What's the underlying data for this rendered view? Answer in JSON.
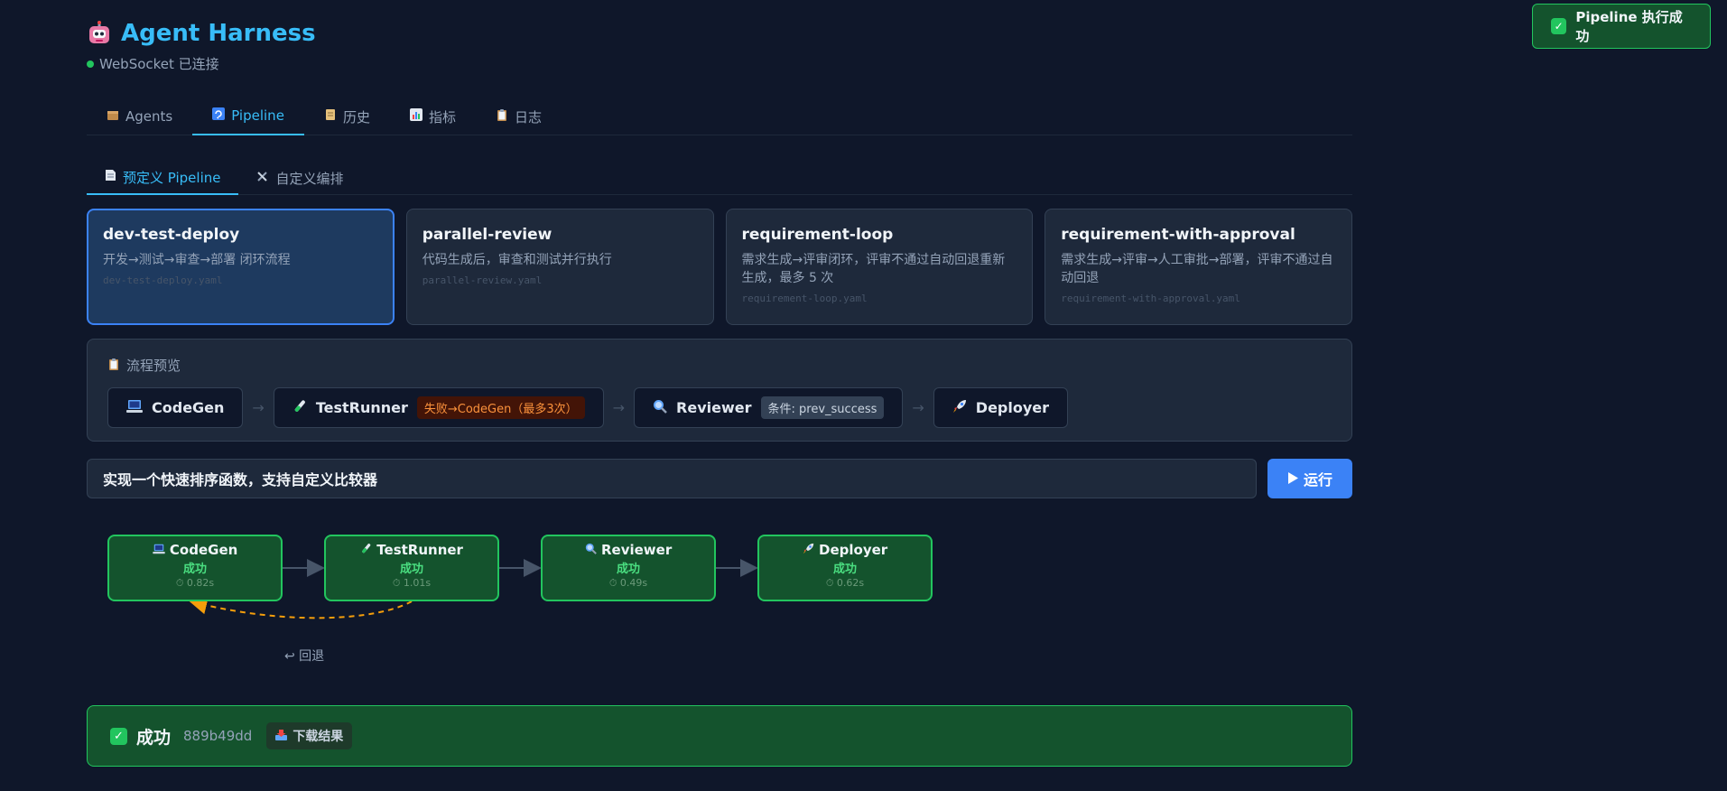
{
  "app": {
    "title": "Agent Harness",
    "connection_status": "WebSocket 已连接"
  },
  "tabs": [
    {
      "label": "Agents",
      "icon": "package-icon"
    },
    {
      "label": "Pipeline",
      "icon": "pipeline-icon",
      "active": true
    },
    {
      "label": "历史",
      "icon": "scroll-icon"
    },
    {
      "label": "指标",
      "icon": "chart-icon"
    },
    {
      "label": "日志",
      "icon": "clipboard-icon"
    }
  ],
  "subtabs": [
    {
      "label": "预定义 Pipeline",
      "icon": "document-icon",
      "active": true
    },
    {
      "label": "自定义编排",
      "icon": "tools-icon"
    }
  ],
  "pipelines": [
    {
      "name": "dev-test-deploy",
      "desc": "开发→测试→审查→部署 闭环流程",
      "file": "dev-test-deploy.yaml",
      "selected": true
    },
    {
      "name": "parallel-review",
      "desc": "代码生成后，审查和测试并行执行",
      "file": "parallel-review.yaml"
    },
    {
      "name": "requirement-loop",
      "desc": "需求生成→评审闭环，评审不通过自动回退重新生成，最多 5 次",
      "file": "requirement-loop.yaml"
    },
    {
      "name": "requirement-with-approval",
      "desc": "需求生成→评审→人工审批→部署，评审不通过自动回退",
      "file": "requirement-with-approval.yaml"
    }
  ],
  "preview": {
    "title": "流程预览",
    "steps": [
      {
        "name": "CodeGen",
        "icon": "laptop-icon"
      },
      {
        "name": "TestRunner",
        "icon": "test-tube-icon",
        "tag": "失败→CodeGen（最多3次）"
      },
      {
        "name": "Reviewer",
        "icon": "magnifier-icon",
        "tag": "条件: prev_success"
      },
      {
        "name": "Deployer",
        "icon": "rocket-icon"
      }
    ],
    "arrow": "→"
  },
  "task_input": {
    "value": "实现一个快速排序函数，支持自定义比较器"
  },
  "run_button": {
    "label": "运行"
  },
  "graph": {
    "nodes": [
      {
        "name": "CodeGen",
        "status": "成功",
        "time": "⏱ 0.82s",
        "icon": "laptop-icon"
      },
      {
        "name": "TestRunner",
        "status": "成功",
        "time": "⏱ 1.01s",
        "icon": "test-tube-icon"
      },
      {
        "name": "Reviewer",
        "status": "成功",
        "time": "⏱ 0.49s",
        "icon": "magnifier-icon"
      },
      {
        "name": "Deployer",
        "status": "成功",
        "time": "⏱ 0.62s",
        "icon": "rocket-icon"
      }
    ],
    "loop_label": "↩ 回退"
  },
  "result": {
    "title": "成功",
    "hash": "889b49dd",
    "download_label": "下载结果"
  },
  "toast": {
    "message": "Pipeline 执行成功"
  },
  "colors": {
    "background": "#0f172a",
    "accent": "#38bdf8",
    "primary": "#3b82f6",
    "success": "#22c55e",
    "warning": "#f59e0b"
  }
}
